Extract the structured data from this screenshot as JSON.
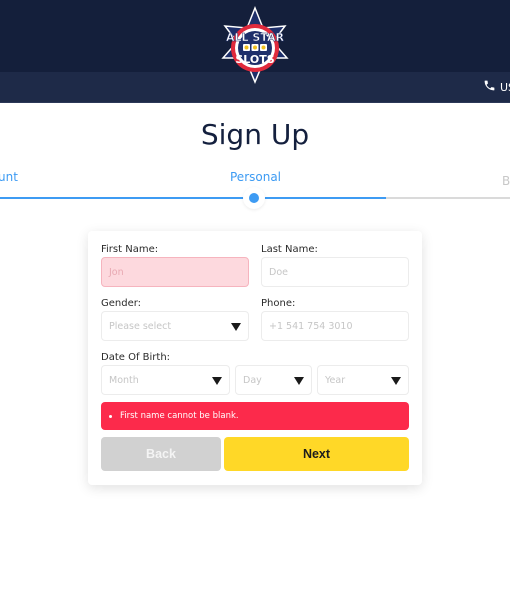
{
  "header": {
    "logo_alt": "All Star Slots",
    "logo_text_top": "ALL STAR",
    "logo_text_bottom": "SLOTS",
    "phone_icon": "phone-icon",
    "phone_text": "US"
  },
  "page": {
    "title": "Sign Up"
  },
  "steps": [
    {
      "label": "Account",
      "visible_text": "unt",
      "state": "completed"
    },
    {
      "label": "Personal",
      "visible_text": "Personal",
      "state": "active"
    },
    {
      "label": "B",
      "visible_text": "B",
      "state": "upcoming"
    }
  ],
  "form": {
    "first_name": {
      "label": "First Name:",
      "placeholder": "Jon",
      "value": "",
      "error": true
    },
    "last_name": {
      "label": "Last Name:",
      "placeholder": "Doe",
      "value": ""
    },
    "gender": {
      "label": "Gender:",
      "selected": "Please select"
    },
    "phone": {
      "label": "Phone:",
      "placeholder": "+1 541 754 3010",
      "value": ""
    },
    "dob": {
      "label": "Date Of Birth:",
      "month": "Month",
      "day": "Day",
      "year": "Year"
    },
    "error_message": "First name cannot be blank.",
    "back_label": "Back",
    "next_label": "Next"
  },
  "colors": {
    "header_bg": "#141f3b",
    "subheader_bg": "#1e2a48",
    "accent_blue": "#3d9bf3",
    "error_red": "#fc2a4b",
    "next_yellow": "#ffd827",
    "back_gray": "#d1d1d1"
  }
}
